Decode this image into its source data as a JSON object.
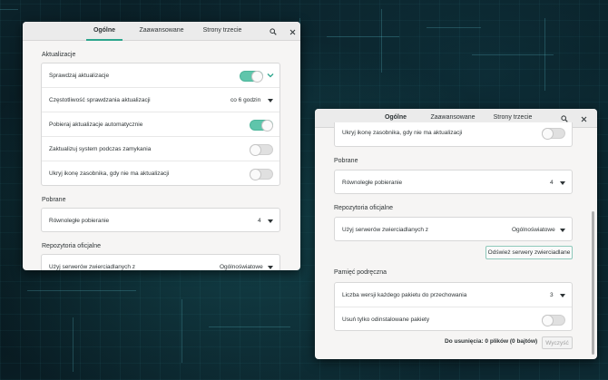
{
  "window1": {
    "tabs": [
      {
        "label": "Ogólne",
        "active": true
      },
      {
        "label": "Zaawansowane",
        "active": false
      },
      {
        "label": "Strony trzecie",
        "active": false
      }
    ],
    "sections": {
      "updates": {
        "title": "Aktualizacje",
        "rows": [
          {
            "label": "Sprawdzaj aktualizacje",
            "switch": true
          },
          {
            "label": "Częstotliwość sprawdzania aktualizacji",
            "value": "co 6 godzin"
          },
          {
            "label": "Pobieraj aktualizacje automatycznie",
            "switch": true
          },
          {
            "label": "Zaktualizuj system podczas zamykania",
            "switch": false
          },
          {
            "label": "Ukryj ikonę zasobnika, gdy nie ma aktualizacji",
            "switch": false
          }
        ]
      },
      "downloads": {
        "title": "Pobrane",
        "rows": [
          {
            "label": "Równoległe pobieranie",
            "value": "4"
          }
        ]
      },
      "repos": {
        "title": "Repozytoria oficjalne",
        "rows": [
          {
            "label": "Użyj serwerów zwierciadlanych z",
            "value": "Ogólnoświatowe"
          }
        ]
      }
    }
  },
  "window2": {
    "tabs": [
      {
        "label": "Ogólne",
        "active": true
      },
      {
        "label": "Zaawansowane",
        "active": false
      },
      {
        "label": "Strony trzecie",
        "active": false
      }
    ],
    "top_row": {
      "label": "Ukryj ikonę zasobnika, gdy nie ma aktualizacji",
      "switch": false
    },
    "sections": {
      "downloads": {
        "title": "Pobrane",
        "rows": [
          {
            "label": "Równoległe pobieranie",
            "value": "4"
          }
        ]
      },
      "repos": {
        "title": "Repozytoria oficjalne",
        "rows": [
          {
            "label": "Użyj serwerów zwierciadlanych z",
            "value": "Ogólnoświatowe"
          }
        ],
        "refresh_button": "Odśwież serwery zwierciadlane"
      },
      "cache": {
        "title": "Pamięć podręczna",
        "rows": [
          {
            "label": "Liczba wersji każdego pakietu do przechowania",
            "value": "3"
          },
          {
            "label": "Usuń tylko odinstalowane pakiety",
            "switch": false
          }
        ]
      }
    },
    "footer": {
      "text": "Do usunięcia:  0 plików  (0 bajtów)",
      "clean_button": "Wyczyść"
    }
  },
  "colors": {
    "accent": "#2ba58c",
    "switch_on": "#5fc5ab"
  },
  "icons": {
    "search": "search-icon",
    "close": "close-icon",
    "expand": "chevron-down-icon"
  }
}
